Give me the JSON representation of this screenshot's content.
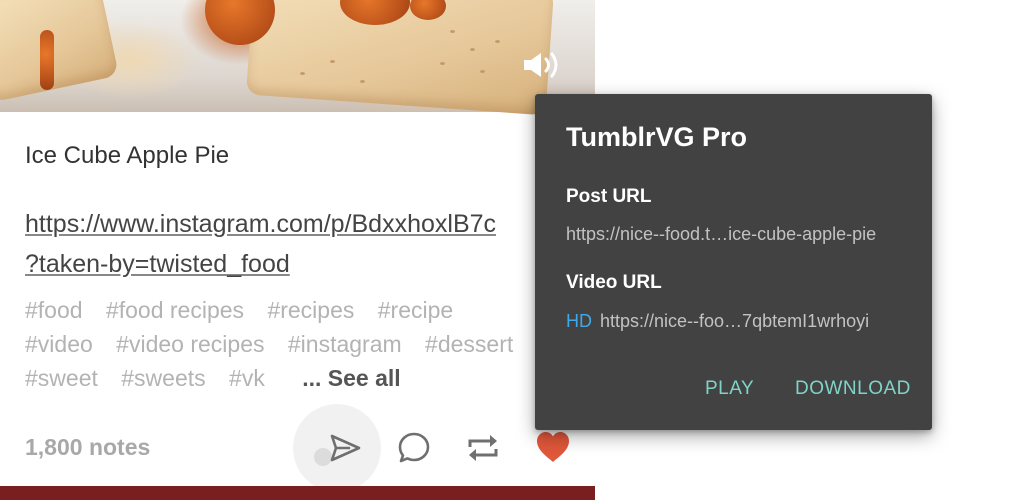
{
  "post": {
    "title": "Ice Cube Apple Pie",
    "link_line1": "https://www.instagram.com/p/BdxxhoxlB7c",
    "link_line2": "?taken-by=twisted_food",
    "tags": [
      [
        "#food",
        "#food recipes",
        "#recipes",
        "#recipe"
      ],
      [
        "#video",
        "#video recipes",
        "#instagram",
        "#dessert"
      ],
      [
        "#sweet",
        "#sweets",
        "#vk"
      ]
    ],
    "see_all": "... See all",
    "notes": "1,800 notes"
  },
  "icons": {
    "volume": "volume-icon",
    "share": "send-icon",
    "reply": "comment-icon",
    "reblog": "reblog-icon",
    "like": "heart-icon"
  },
  "colors": {
    "heart": "#e0573a",
    "dialog_bg": "#424242",
    "accent_button": "#7fd4c8",
    "hd_badge": "#40a9e8",
    "bottom_bar": "#7a1f1f"
  },
  "dialog": {
    "title": "TumblrVG Pro",
    "post_url_label": "Post URL",
    "post_url_value": "https://nice--food.t…ice-cube-apple-pie",
    "video_url_label": "Video URL",
    "video_quality": "HD",
    "video_url_value": "https://nice--foo…7qbtemI1wrhoyi",
    "play_button": "PLAY",
    "download_button": "DOWNLOAD"
  }
}
